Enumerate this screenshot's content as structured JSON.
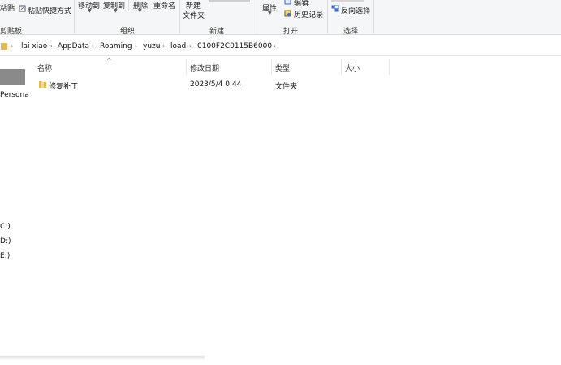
{
  "ribbon": {
    "clipboard": {
      "paste_label": "粘贴",
      "paste_shortcut_label": "粘贴快捷方式",
      "group_label": "剪贴板"
    },
    "organize": {
      "move_to_label": "移动到",
      "copy_to_label": "复制到",
      "delete_label": "删除",
      "rename_label": "重命名",
      "group_label": "组织"
    },
    "new": {
      "new_folder_line1": "新建",
      "new_folder_line2": "文件夹",
      "group_label": "新建"
    },
    "open": {
      "properties_label": "属性",
      "edit_label": "编辑",
      "history_label": "历史记录",
      "group_label": "打开"
    },
    "select": {
      "invert_label": "反向选择",
      "group_label": "选择"
    }
  },
  "address": {
    "crumbs": [
      "lai xiao",
      "AppData",
      "Roaming",
      "yuzu",
      "load",
      "0100F2C0115B6000"
    ]
  },
  "nav": {
    "items": [
      "Persona",
      "C:)",
      "D:)",
      "E:)"
    ]
  },
  "columns": {
    "name": "名称",
    "modified": "修改日期",
    "type": "类型",
    "size": "大小"
  },
  "files": [
    {
      "name": "修复补丁",
      "modified": "2023/5/4 0:44",
      "type": "文件夹",
      "size": ""
    }
  ],
  "colors": {
    "folder": "#e8b84a",
    "ribbon_bg": "#f5f6f7",
    "accent_icon": "#3a6fd8"
  }
}
